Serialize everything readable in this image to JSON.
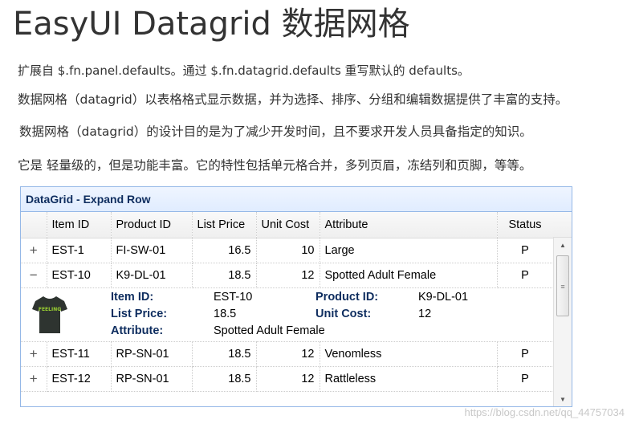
{
  "page": {
    "title": "EasyUI Datagrid 数据网格",
    "paragraphs": [
      "扩展自 $.fn.panel.defaults。通过 $.fn.datagrid.defaults 重写默认的 defaults。",
      "数据网格（datagrid）以表格格式显示数据，并为选择、排序、分组和编辑数据提供了丰富的支持。",
      "数据网格（datagrid）的设计目的是为了减少开发时间，且不要求开发人员具备指定的知识。",
      "它是 轻量级的，但是功能丰富。它的特性包括单元格合并，多列页眉，冻结列和页脚，等等。"
    ]
  },
  "grid": {
    "title": "DataGrid - Expand Row",
    "columns": [
      "Item ID",
      "Product ID",
      "List Price",
      "Unit Cost",
      "Attribute",
      "Status"
    ],
    "rows": [
      {
        "expanded": false,
        "toggle": "+",
        "item_id": "EST-1",
        "product_id": "FI-SW-01",
        "list_price": "16.5",
        "unit_cost": "10",
        "attribute": "Large",
        "status": "P"
      },
      {
        "expanded": true,
        "toggle": "−",
        "item_id": "EST-10",
        "product_id": "K9-DL-01",
        "list_price": "18.5",
        "unit_cost": "12",
        "attribute": "Spotted Adult Female",
        "status": "P"
      },
      {
        "expanded": false,
        "toggle": "+",
        "item_id": "EST-11",
        "product_id": "RP-SN-01",
        "list_price": "18.5",
        "unit_cost": "12",
        "attribute": "Venomless",
        "status": "P"
      },
      {
        "expanded": false,
        "toggle": "+",
        "item_id": "EST-12",
        "product_id": "RP-SN-01",
        "list_price": "18.5",
        "unit_cost": "12",
        "attribute": "Rattleless",
        "status": "P"
      }
    ],
    "detail": {
      "image_icon": "tshirt-icon",
      "image_text": "FEELING",
      "item_id_label": "Item ID:",
      "item_id": "EST-10",
      "product_id_label": "Product ID:",
      "product_id": "K9-DL-01",
      "list_price_label": "List Price:",
      "list_price": "18.5",
      "unit_cost_label": "Unit Cost:",
      "unit_cost": "12",
      "attribute_label": "Attribute:",
      "attribute": "Spotted Adult Female"
    },
    "colors": {
      "header_text": "#0e2d5f",
      "panel_border": "#95b8e7"
    }
  },
  "watermark": "https://blog.csdn.net/qq_44757034"
}
